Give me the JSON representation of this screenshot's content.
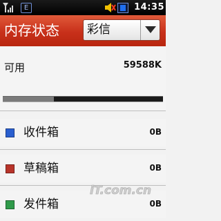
{
  "status_bar": {
    "time": "14:35",
    "network_letter": "E",
    "icons": [
      "signal-icon",
      "network-e-icon",
      "mute-icon",
      "battery-icon"
    ]
  },
  "header": {
    "title": "内存状态",
    "dropdown_value": "彩信"
  },
  "memory": {
    "available_label": "可用",
    "available_value": "59588K",
    "used_fraction": 0.32
  },
  "folders": [
    {
      "name": "收件箱",
      "size": "0B",
      "color": "#2a5fcf"
    },
    {
      "name": "草稿箱",
      "size": "0B",
      "color": "#b8342a"
    },
    {
      "name": "发件箱",
      "size": "0B",
      "color": "#2f9a4a"
    }
  ],
  "watermark": "iT.com.cn",
  "colors": {
    "title_bar": "#c8301a",
    "status_bar": "#000000"
  }
}
